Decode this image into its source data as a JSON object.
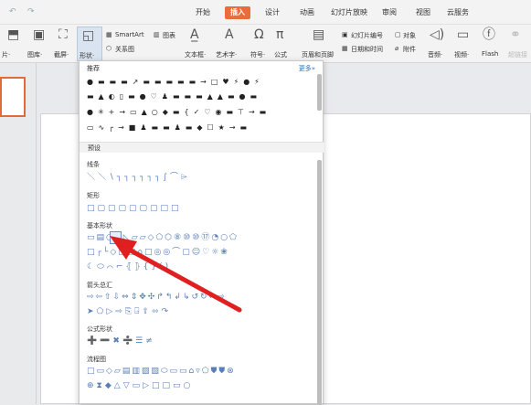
{
  "titlebar": {
    "undo": "↶",
    "redo": "↷",
    "tabs": [
      "开始",
      "插入",
      "设计",
      "动画",
      "幻灯片放映",
      "审阅",
      "视图",
      "云服务"
    ],
    "active_tab": "插入"
  },
  "ribbon": {
    "labels": {
      "left1": "片·",
      "image": "图库·",
      "screenshot": "截屏·",
      "shape": "形状·",
      "smartart": "SmartArt",
      "chart": "图表",
      "relation": "关系图",
      "textbox": "文本框·",
      "arttext": "艺术字·",
      "symbol": "符号·",
      "formula": "公式",
      "headerfooter": "页眉和页脚",
      "slidenum": "幻灯片编号",
      "object": "对象",
      "datetime": "日期和时间",
      "attach": "附件",
      "audio": "音频·",
      "video": "视频·",
      "flash": "Flash",
      "hyperlink": "超链接"
    }
  },
  "panel": {
    "recommend": "推荐",
    "more": "更多»",
    "preset": "预设",
    "categories": [
      "线条",
      "矩形",
      "基本形状",
      "箭头总汇",
      "公式形状",
      "流程图"
    ],
    "rec_rows": [
      "●▬▬▬↗▬▬▬▬▬→□♥⚡●⚡",
      "▬▲◐▯▬●♡♟▬▬▬▲▲▬●▬",
      "●✳+→▭▲○◆▬{✓♡◉▬⊤→▬",
      "▭∿┌→■♟▬▬♟▬◆☐★→▬"
    ],
    "line_row": "＼＼∖┐┐┐┐┐┐∫⌒⌲",
    "rect_row": "□▢▢▢▢▢▢□□",
    "basic_rows": [
      "▭▤○△◺▱▱◇⬠⬡⑧⑩⑩⑰◔○⬠",
      "□┌└◇□□⌂□◎◎⌒▢☺♡☼❀",
      "☾⬭⌒⌐⦃⦄{}()"
    ],
    "arrow_rows": [
      "⇨⇦⇧⇩⇔⇕✥✣↱↰↲↳↺↻↫⇨",
      "➤⬠▷⇨⎘⍈⇪⬄↷"
    ],
    "formula_row": "➕➖✖➗☰≠",
    "flow_rows": [
      "□▭◇▱▤▥▨▧⬭▭▭⌂▿⬠⛊⛊⊗",
      "⊕⧗◆△▽▭▷□□▭○"
    ]
  },
  "colors": {
    "accent": "#ea6c3a",
    "shape_blue": "#5a7fb8",
    "arrow_red": "#e02020"
  }
}
